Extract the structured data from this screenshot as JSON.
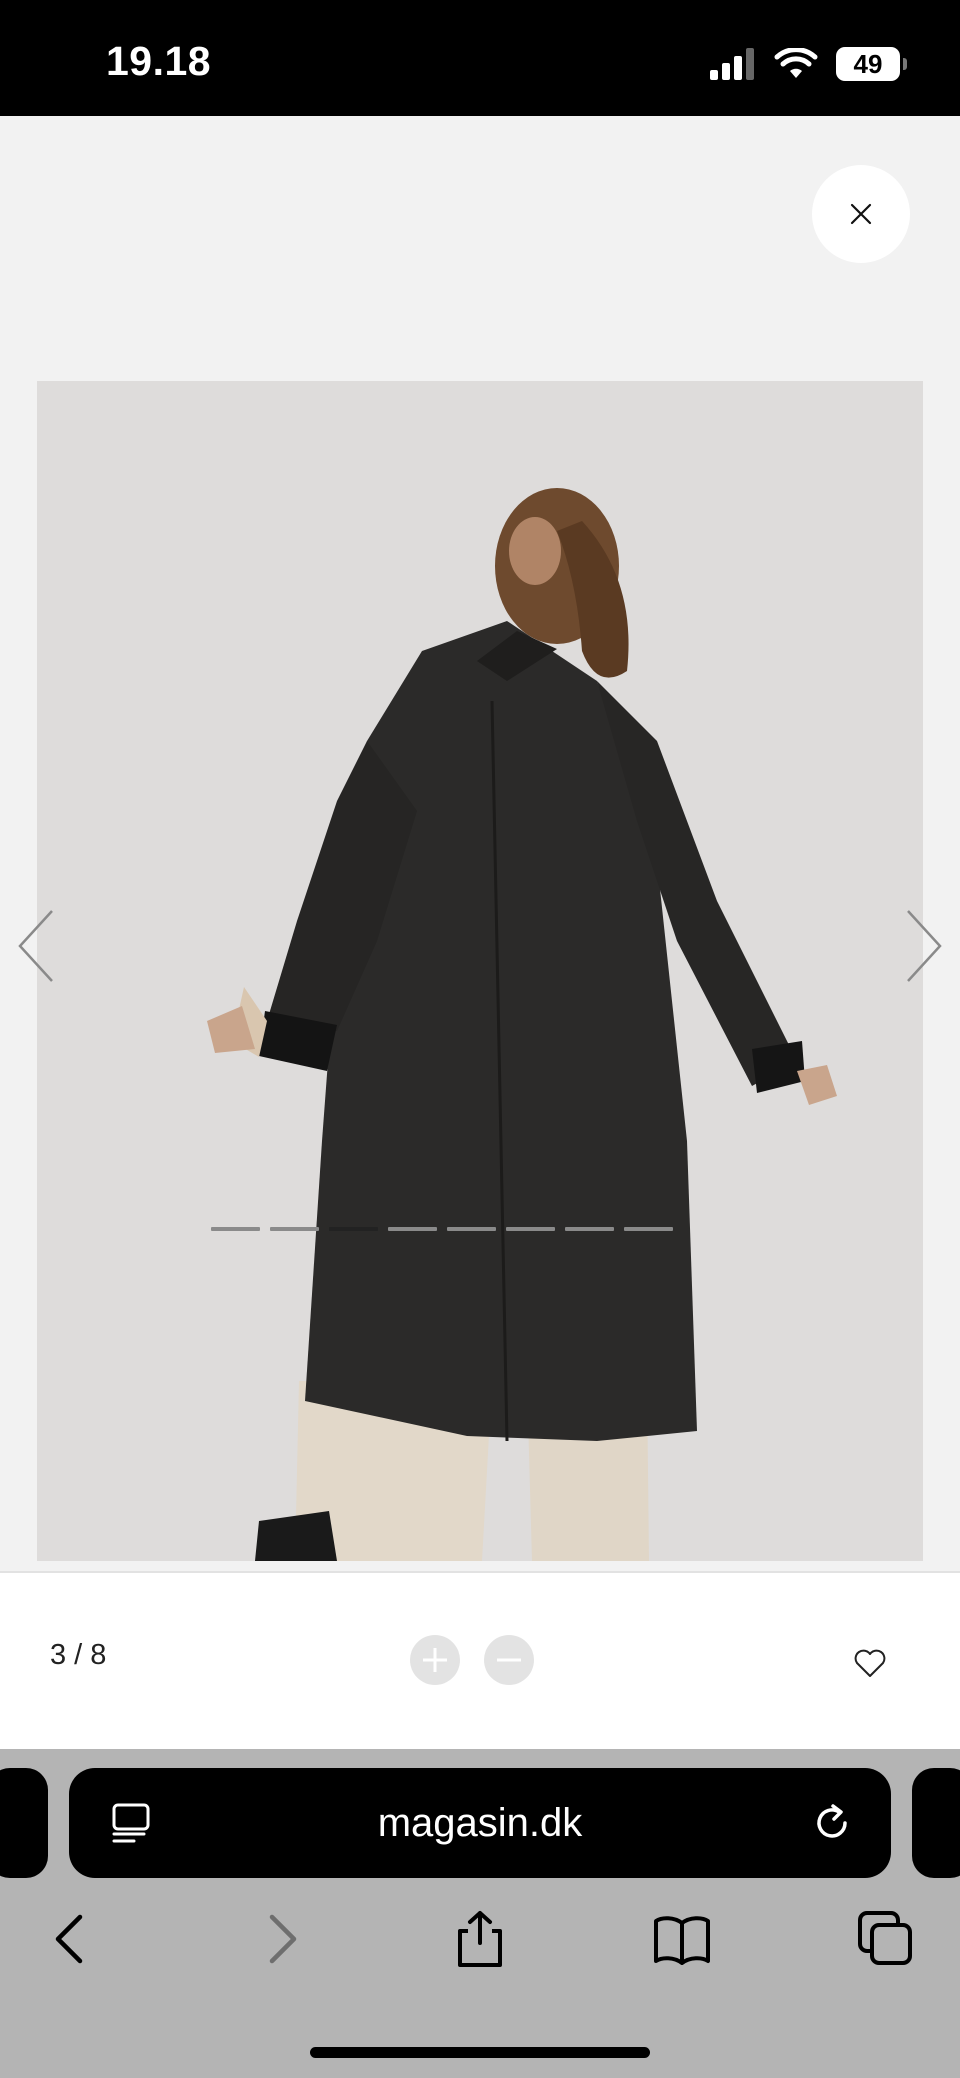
{
  "status_bar": {
    "time": "19.18",
    "battery": "49",
    "icons": [
      "cellular-signal-icon",
      "wifi-icon",
      "battery-icon"
    ]
  },
  "viewer": {
    "image_alt": "Woman in long black coat viewed from behind",
    "slide_count": 8,
    "active_slide": 3,
    "counter": "3 / 8",
    "icons": [
      "close-icon",
      "chevron-left-icon",
      "chevron-right-icon",
      "zoom-in-icon",
      "zoom-out-icon",
      "heart-icon"
    ]
  },
  "browser": {
    "url": "magasin.dk",
    "icons": [
      "reader-icon",
      "reload-icon",
      "back-icon",
      "forward-icon",
      "share-icon",
      "bookmarks-icon",
      "tabs-icon"
    ]
  },
  "colors": {
    "status_bar_bg": "#000000",
    "viewer_bg": "#f2f2f2",
    "browser_bar_bg": "#b4b4b4",
    "progress_active": "#222222",
    "progress_inactive": "#8a8a8a"
  }
}
